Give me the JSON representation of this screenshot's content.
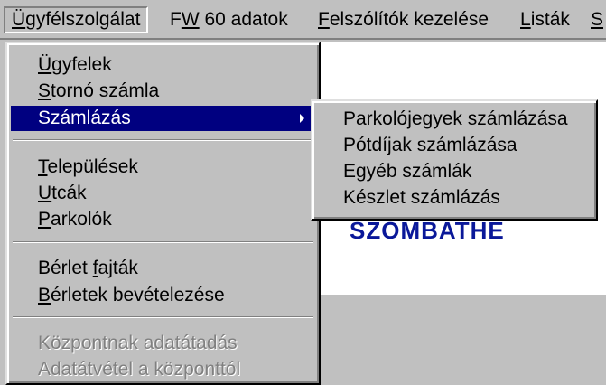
{
  "menubar": {
    "items": [
      {
        "pre": "",
        "ul": "Ü",
        "post": "gyfélszolgálat"
      },
      {
        "pre": "F",
        "ul": "W",
        "post": " 60 adatok"
      },
      {
        "pre": "",
        "ul": "F",
        "post": "elszólítók kezelése"
      },
      {
        "pre": "",
        "ul": "L",
        "post": "isták"
      },
      {
        "pre": "",
        "ul": "S",
        "post": ""
      }
    ]
  },
  "main_menu": {
    "items": [
      {
        "pre": "",
        "ul": "Ü",
        "post": "gyfelek"
      },
      {
        "pre": "",
        "ul": "S",
        "post": "tornó számla"
      },
      {
        "pre": "",
        "ul": "",
        "post": "Számlázás"
      },
      {
        "pre": "",
        "ul": "T",
        "post": "elepülések"
      },
      {
        "pre": "",
        "ul": "U",
        "post": "tcák"
      },
      {
        "pre": "",
        "ul": "P",
        "post": "arkolók"
      },
      {
        "pre": "Bérlet ",
        "ul": "f",
        "post": "ajták"
      },
      {
        "pre": "",
        "ul": "B",
        "post": "érletek bevételezése"
      },
      {
        "pre": "",
        "ul": "",
        "post": "Központnak adatátadás"
      },
      {
        "pre": "",
        "ul": "",
        "post": "Adatátvétel a központtól"
      }
    ]
  },
  "sub_menu": {
    "items": [
      {
        "label": "Parkolójegyek számlázása"
      },
      {
        "label": "Pótdíjak számlázása"
      },
      {
        "label": "Egyéb számlák"
      },
      {
        "label": "Készlet számlázás"
      }
    ]
  },
  "background": {
    "city_text": "SZOMBATHE"
  },
  "colors": {
    "menu_bg": "#c0c0c0",
    "highlight": "#000080",
    "disabled_text": "#808080",
    "city_text": "#0a1899"
  },
  "icons": {
    "submenu_arrow": "chevron-right-icon"
  }
}
